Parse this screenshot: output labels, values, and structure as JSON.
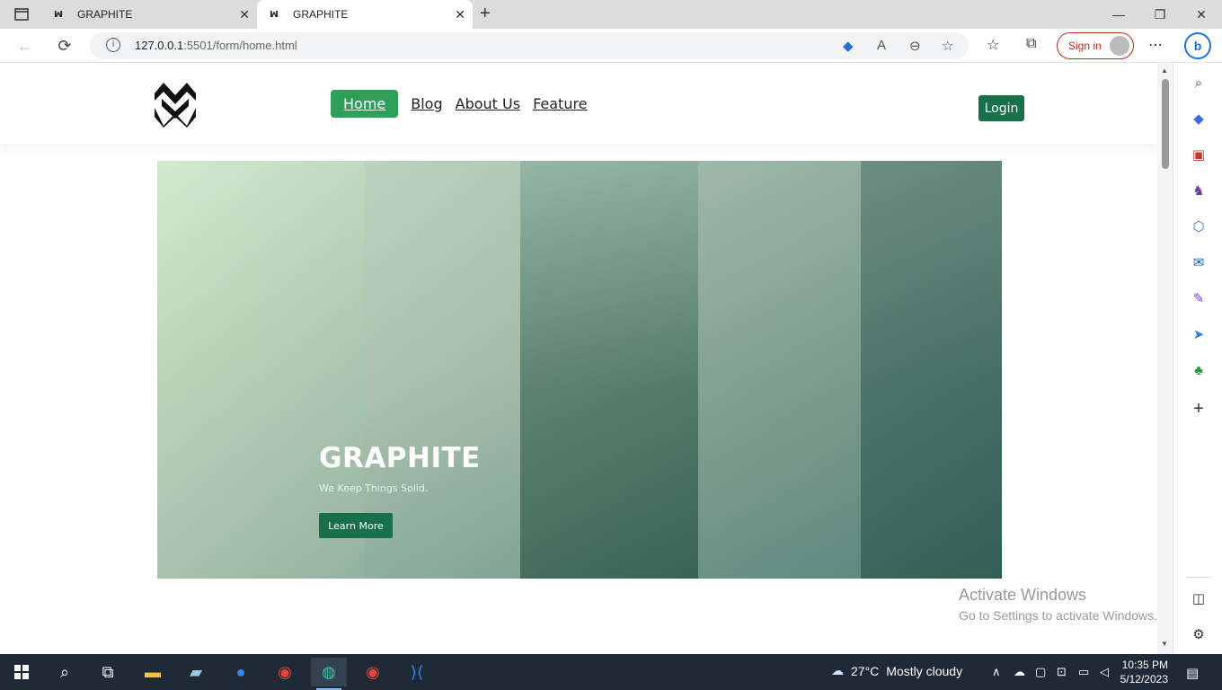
{
  "browser": {
    "tabs": [
      {
        "title": "GRAPHITE",
        "favicon": "ꟽ"
      },
      {
        "title": "GRAPHITE",
        "favicon": "ꟽ"
      }
    ],
    "new_tab": "+",
    "url_host": "127.0.0.1",
    "url_rest": ":5501/form/home.html",
    "signin_label": "Sign in",
    "window": {
      "minimize": "—",
      "restore": "❐",
      "close": "✕"
    }
  },
  "site": {
    "nav": {
      "items": [
        {
          "label": "Home",
          "active": true
        },
        {
          "label": "Blog",
          "active": false
        },
        {
          "label": "About Us",
          "active": false
        },
        {
          "label": "Feature",
          "active": false
        }
      ],
      "login_label": "Login"
    },
    "hero": {
      "title": "GRAPHITE",
      "subtitle": "We Keep Things Solid.",
      "cta_label": "Learn More"
    },
    "colors": {
      "primary": "#17704a",
      "active_nav": "#2e9e5b"
    }
  },
  "watermark": {
    "line1": "Activate Windows",
    "line2": "Go to Settings to activate Windows."
  },
  "taskbar": {
    "weather_temp": "27°C",
    "weather_desc": "Mostly cloudy",
    "time": "10:35 PM",
    "date": "5/12/2023"
  }
}
